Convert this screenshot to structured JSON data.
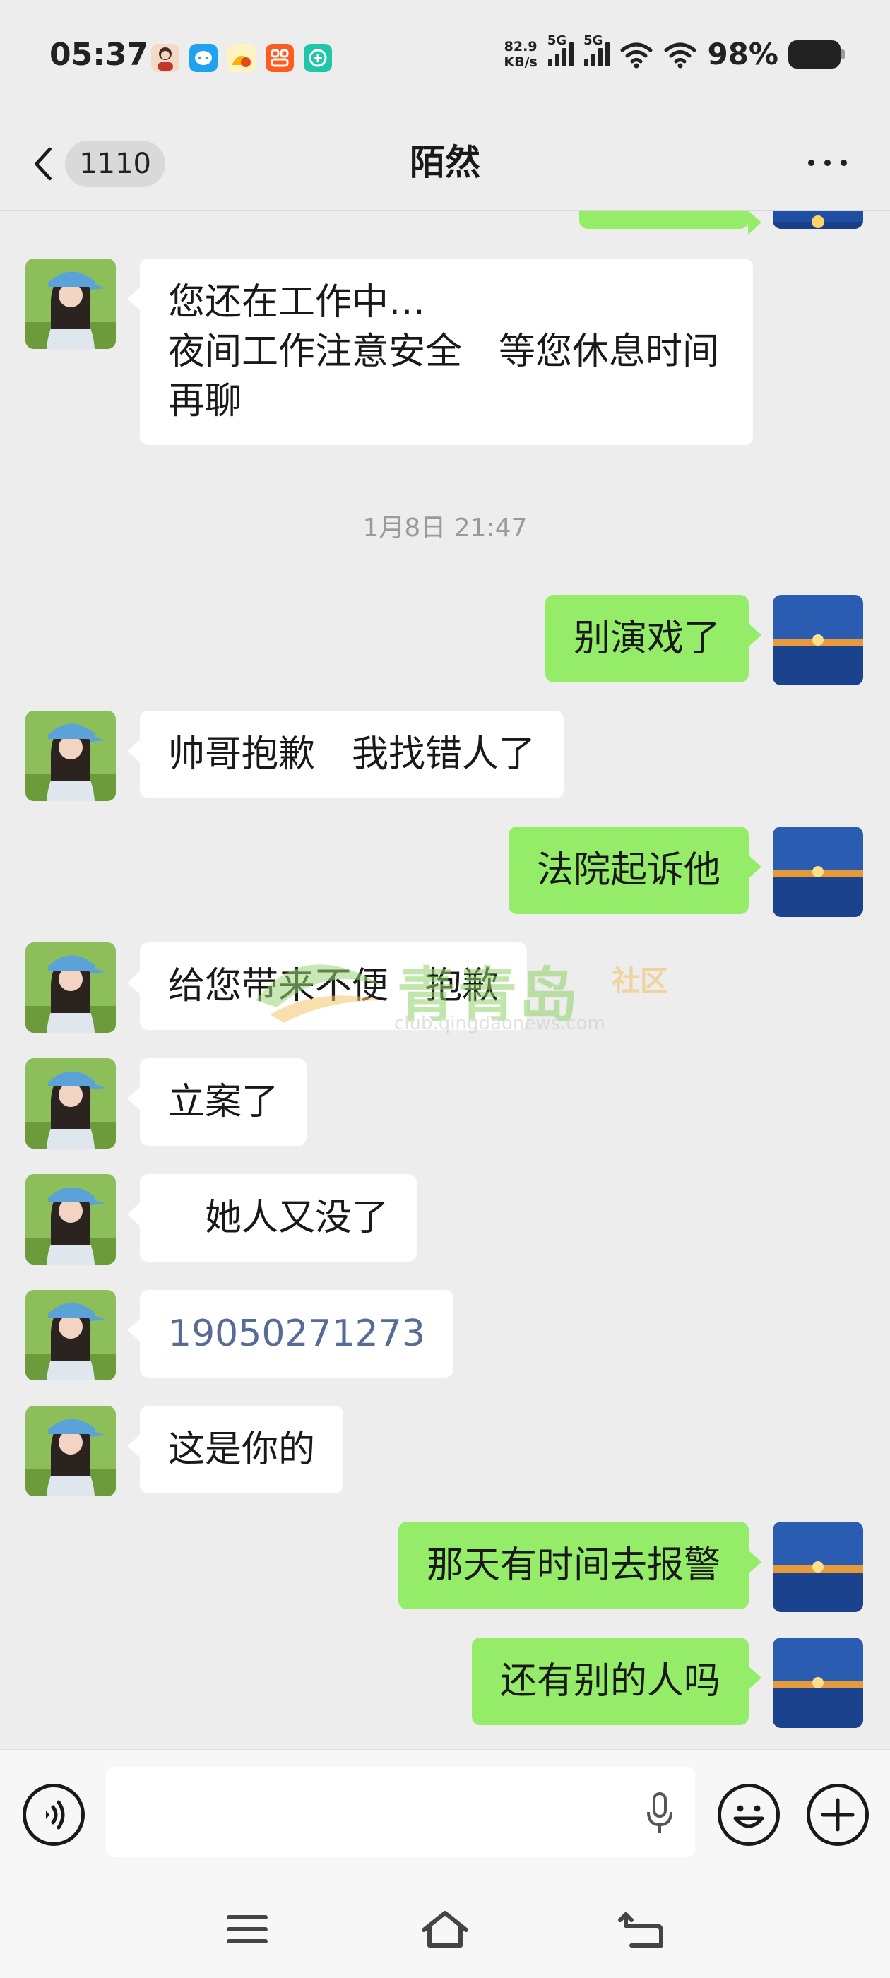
{
  "status_bar": {
    "time": "05:37",
    "net_speed_value": "82.9",
    "net_speed_unit": "KB/s",
    "sim1_label": "5G",
    "sim2_label": "5G",
    "battery_percent": "98%",
    "app_icons": [
      "avatar-notification-icon",
      "chat-app-icon",
      "pinyin-app-icon",
      "shopping-app-icon",
      "health-app-icon"
    ]
  },
  "header": {
    "back_unread_count": "1110",
    "title": "陌然"
  },
  "messages": [
    {
      "side": "in",
      "lines": [
        "您还在工作中…",
        "夜间工作注意安全　等您休息时间",
        "再聊"
      ]
    },
    {
      "type": "timestamp",
      "text": "1月8日 21:47"
    },
    {
      "side": "out",
      "text": "别演戏了"
    },
    {
      "side": "in",
      "text": "帅哥抱歉　我找错人了"
    },
    {
      "side": "out",
      "text": "法院起诉他"
    },
    {
      "side": "in",
      "text": "给您带来不便　抱歉"
    },
    {
      "side": "in",
      "text": "立案了"
    },
    {
      "side": "in",
      "text": "　她人又没了"
    },
    {
      "side": "in",
      "text": "19050271273",
      "link": true
    },
    {
      "side": "in",
      "text": "这是你的"
    },
    {
      "side": "out",
      "text": "那天有时间去报警"
    },
    {
      "side": "out",
      "text": "还有别的人吗"
    }
  ],
  "watermark": {
    "title": "青青岛",
    "suffix": "社区",
    "url": "club.qingdaonews.com"
  },
  "input_bar": {
    "voice_icon": "voice-mode-icon",
    "mic_icon": "microphone-icon",
    "emoji_icon": "emoji-icon",
    "plus_icon": "plus-icon"
  },
  "colors": {
    "background": "#ededed",
    "incoming_bubble": "#ffffff",
    "outgoing_bubble": "#95ec69",
    "link": "#576b95",
    "timestamp": "#9a9a9a"
  }
}
